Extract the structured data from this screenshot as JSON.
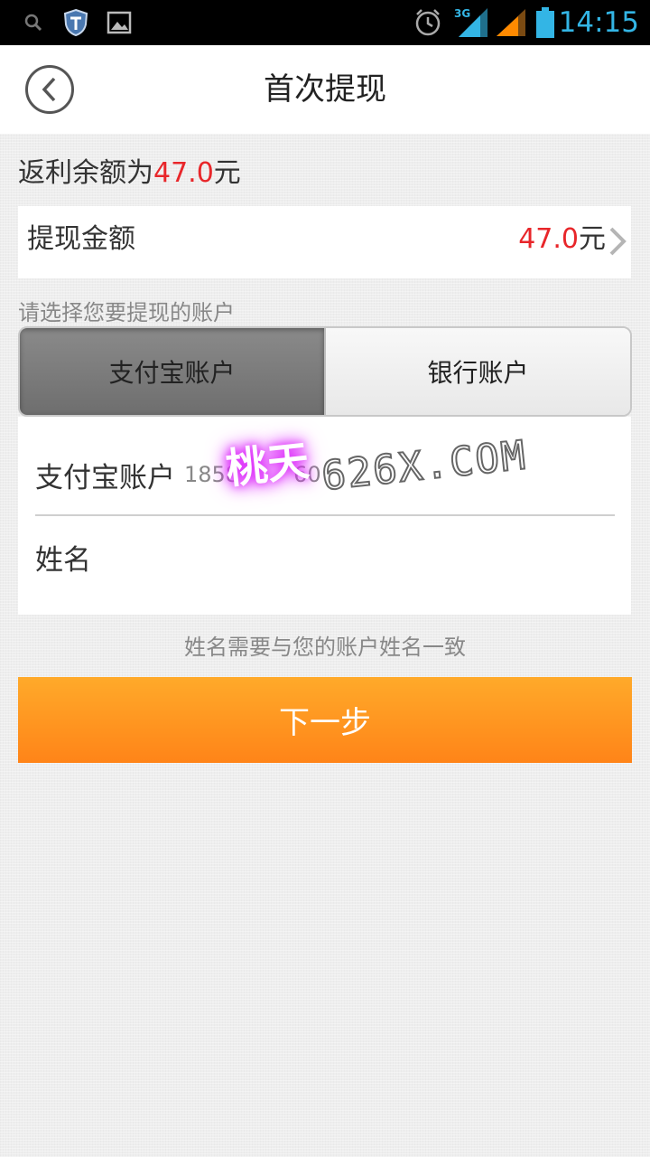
{
  "status_bar": {
    "time": "14:15",
    "network": "3G",
    "icons": [
      "search-icon",
      "shield-icon",
      "image-icon",
      "alarm-icon",
      "signal-3g-icon",
      "signal-icon",
      "battery-icon"
    ],
    "time_color": "#33b5e5"
  },
  "header": {
    "title": "首次提现",
    "back_icon": "back-circle-icon"
  },
  "balance": {
    "prefix": "返利余额为",
    "amount": "47.0",
    "suffix": "元"
  },
  "withdraw_amount": {
    "label": "提现金额",
    "value": "47.0",
    "unit": "元"
  },
  "account_hint": "请选择您要提现的账户",
  "tabs": [
    {
      "label": "支付宝账户",
      "active": true
    },
    {
      "label": "银行账户",
      "active": false
    }
  ],
  "form": {
    "alipay_label": "支付宝账户",
    "alipay_value": "1858",
    "alipay_value_tail": "60",
    "name_label": "姓名"
  },
  "watermark": {
    "cn": "桃天",
    "en": "626X.COM"
  },
  "note": "姓名需要与您的账户姓名一致",
  "next_button": "下一步",
  "colors": {
    "accent_red": "#e8262a",
    "button_orange": "#ff9a22"
  }
}
